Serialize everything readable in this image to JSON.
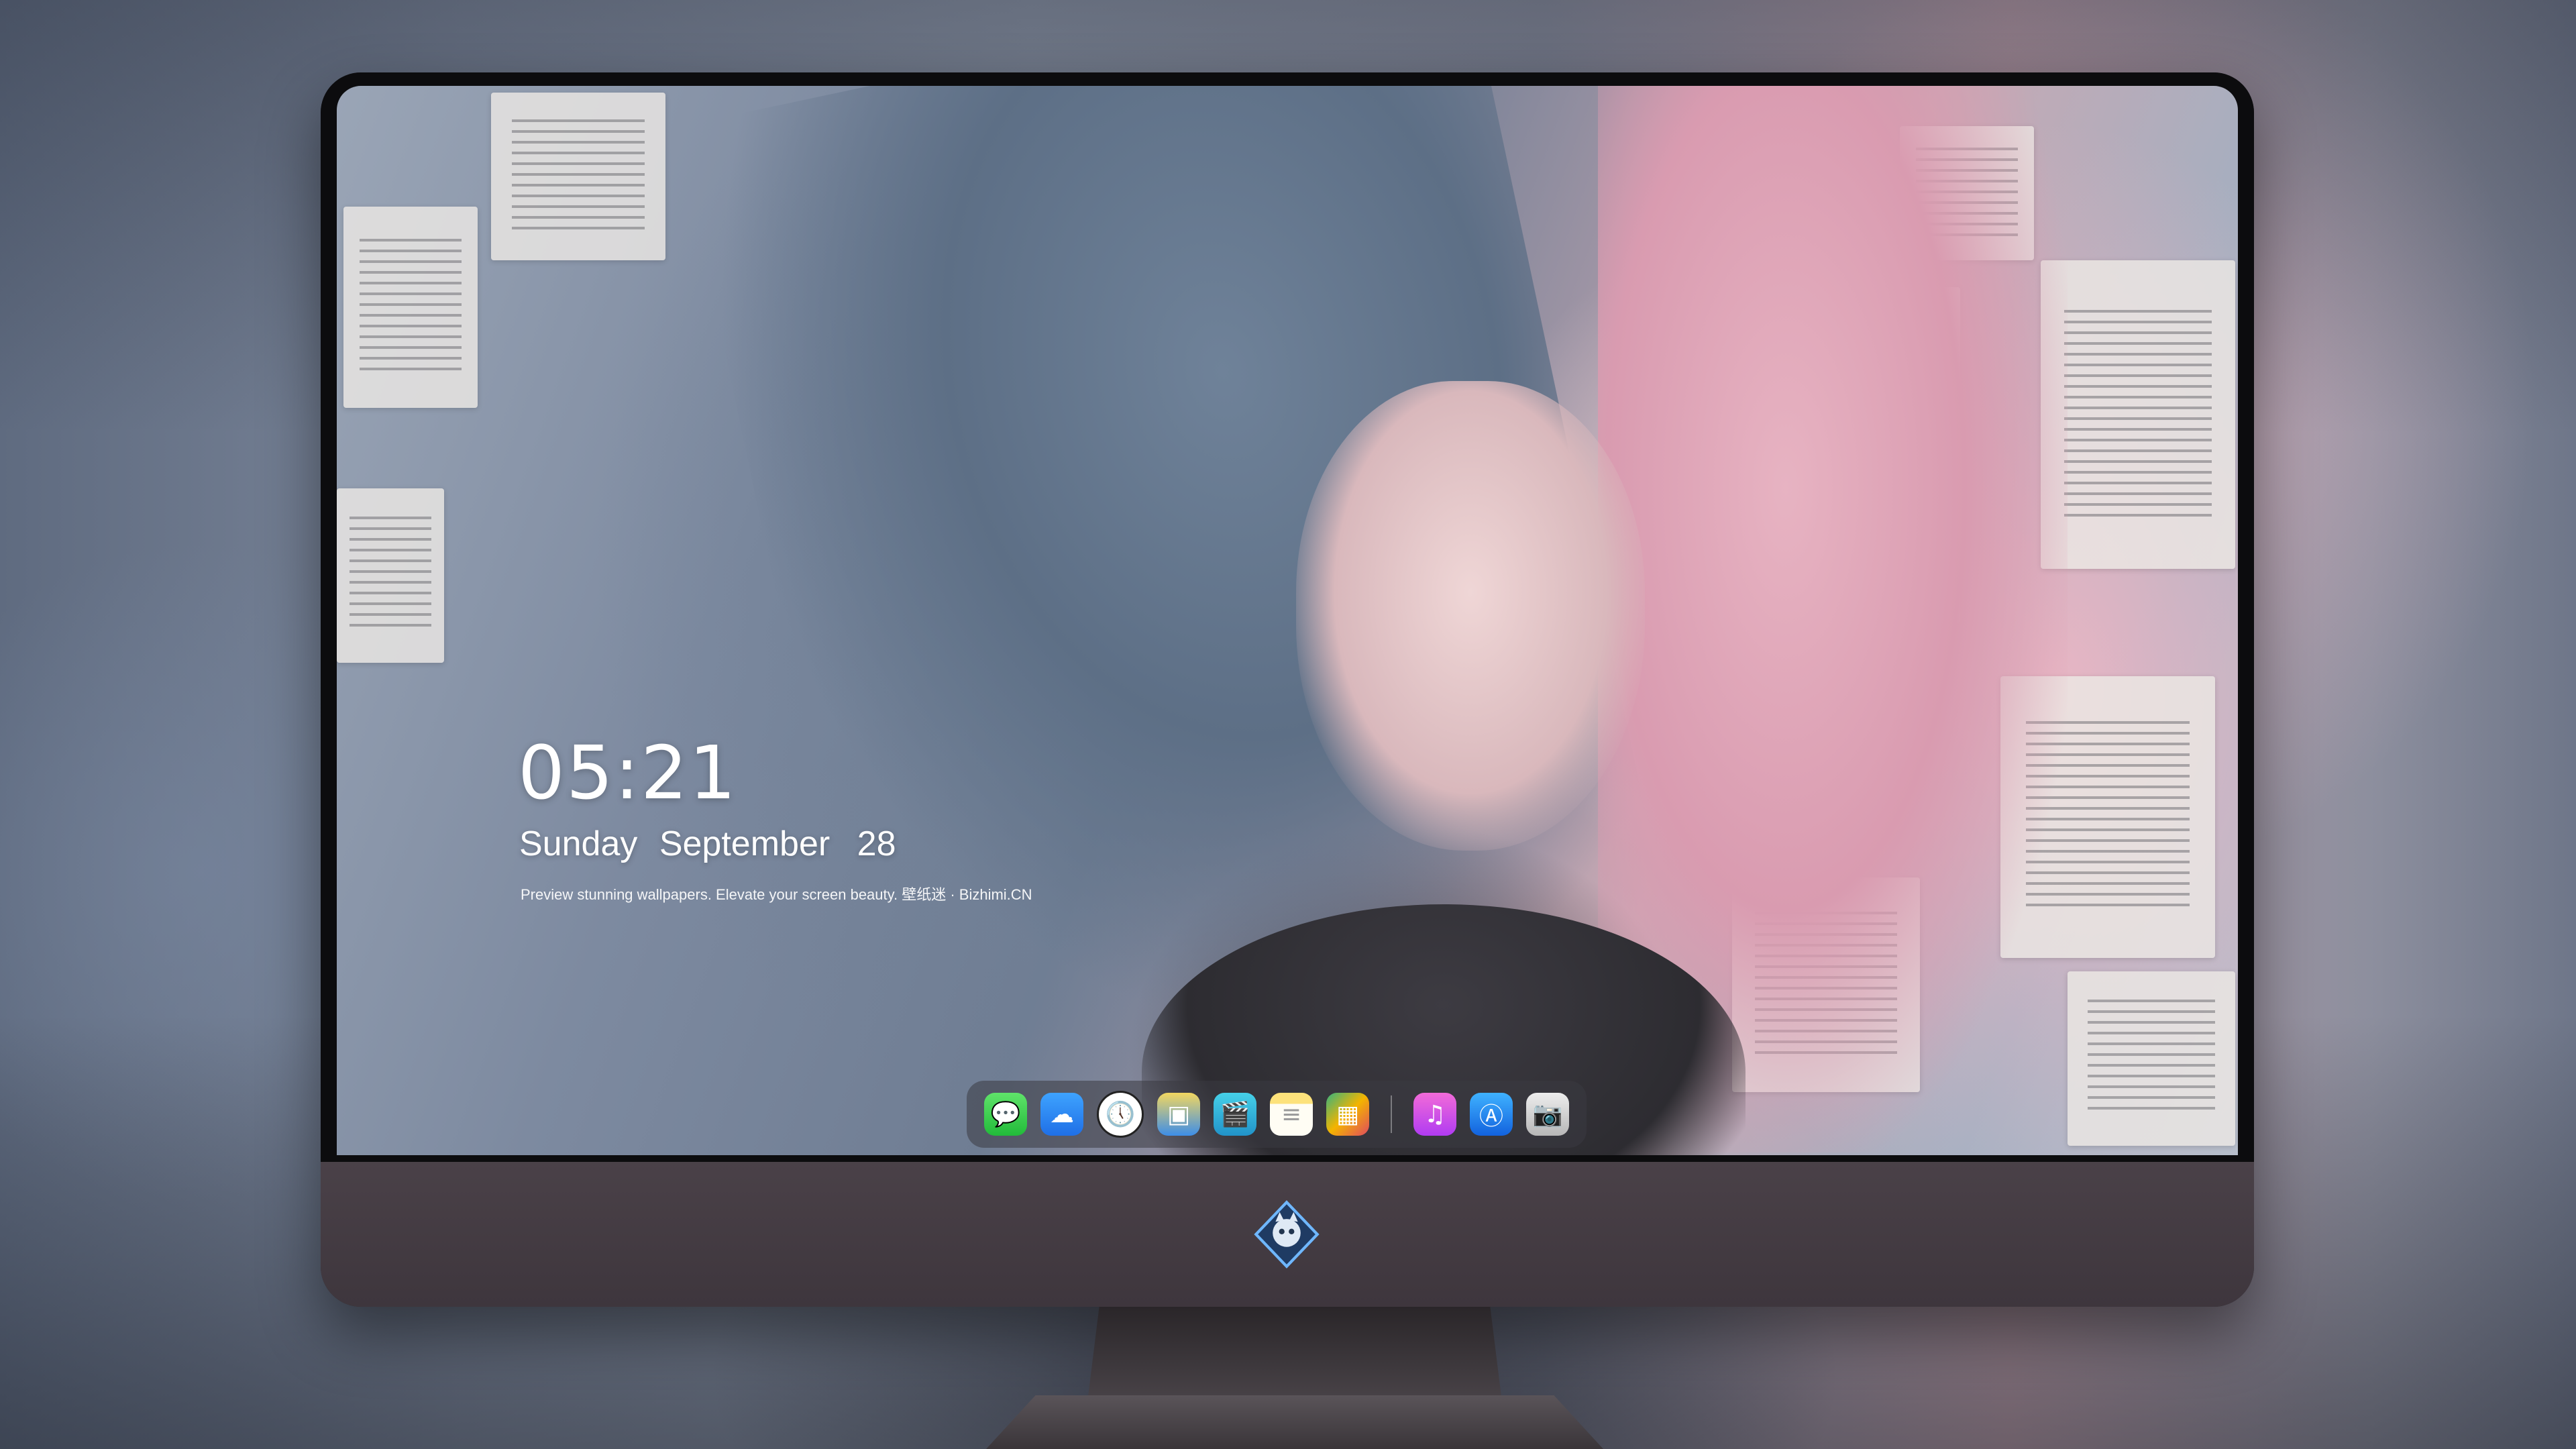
{
  "lock_screen": {
    "time": "05:21",
    "weekday": "Sunday",
    "month": "September",
    "day": "28",
    "tagline": "Preview stunning wallpapers. Elevate your screen beauty. 壁纸迷 · Bizhimi.CN"
  },
  "dock": {
    "items": [
      {
        "name": "messages",
        "icon": "message-bubble-icon",
        "glyph": "💬"
      },
      {
        "name": "weather",
        "icon": "cloud-sun-icon",
        "glyph": "☁"
      },
      {
        "name": "clock",
        "icon": "clock-icon",
        "glyph": "🕔"
      },
      {
        "name": "preview",
        "icon": "image-preview-icon",
        "glyph": "▣"
      },
      {
        "name": "video",
        "icon": "clapperboard-icon",
        "glyph": "🎬"
      },
      {
        "name": "notes",
        "icon": "notes-icon",
        "glyph": "≡"
      },
      {
        "name": "grid-app",
        "icon": "grid-tiles-icon",
        "glyph": "▦"
      },
      {
        "name": "music",
        "icon": "music-note-icon",
        "glyph": "♫"
      },
      {
        "name": "app-store",
        "icon": "app-store-icon",
        "glyph": "Ⓐ"
      },
      {
        "name": "camera",
        "icon": "camera-icon",
        "glyph": "📷"
      }
    ]
  },
  "colors": {
    "accent_pink": "#e7b3c2",
    "accent_blue": "#6f8299",
    "monitor_chin": "#433b42"
  }
}
